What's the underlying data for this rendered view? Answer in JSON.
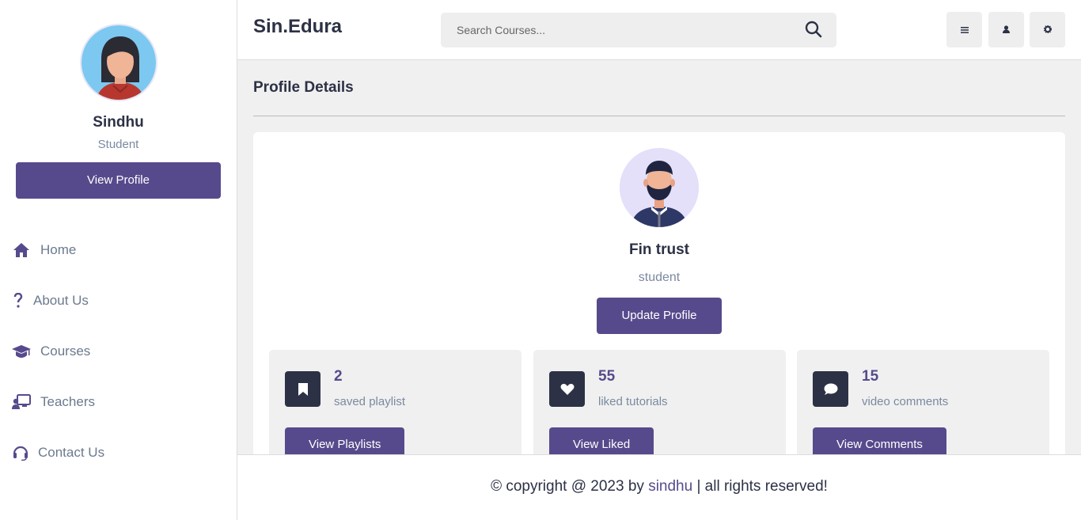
{
  "sidebar": {
    "user_name": "Sindhu",
    "user_role": "Student",
    "view_profile_label": "View Profile",
    "nav": [
      {
        "label": "Home",
        "icon": "home-icon"
      },
      {
        "label": "About Us",
        "icon": "question-icon"
      },
      {
        "label": "Courses",
        "icon": "graduation-cap-icon"
      },
      {
        "label": "Teachers",
        "icon": "teacher-icon"
      },
      {
        "label": "Contact Us",
        "icon": "headset-icon"
      }
    ]
  },
  "header": {
    "logo": "Sin.Edura",
    "search_placeholder": "Search Courses...",
    "buttons": [
      "menu-icon",
      "user-icon",
      "settings-icon"
    ]
  },
  "main": {
    "heading": "Profile Details",
    "profile": {
      "name": "Fin trust",
      "role": "student",
      "update_label": "Update Profile"
    },
    "stats": [
      {
        "number": "2",
        "label": "saved playlist",
        "button": "View Playlists",
        "icon": "bookmark-icon"
      },
      {
        "number": "55",
        "label": "liked tutorials",
        "button": "View Liked",
        "icon": "heart-icon"
      },
      {
        "number": "15",
        "label": "video comments",
        "button": "View Comments",
        "icon": "comment-icon"
      }
    ]
  },
  "footer": {
    "prefix": "© copyright @ 2023 by ",
    "author": "sindhu",
    "suffix": " | all rights reserved!"
  },
  "colors": {
    "accent": "#574a8c",
    "dark": "#2c3145",
    "muted": "#7a8aa0",
    "background": "#f0f0f0"
  }
}
